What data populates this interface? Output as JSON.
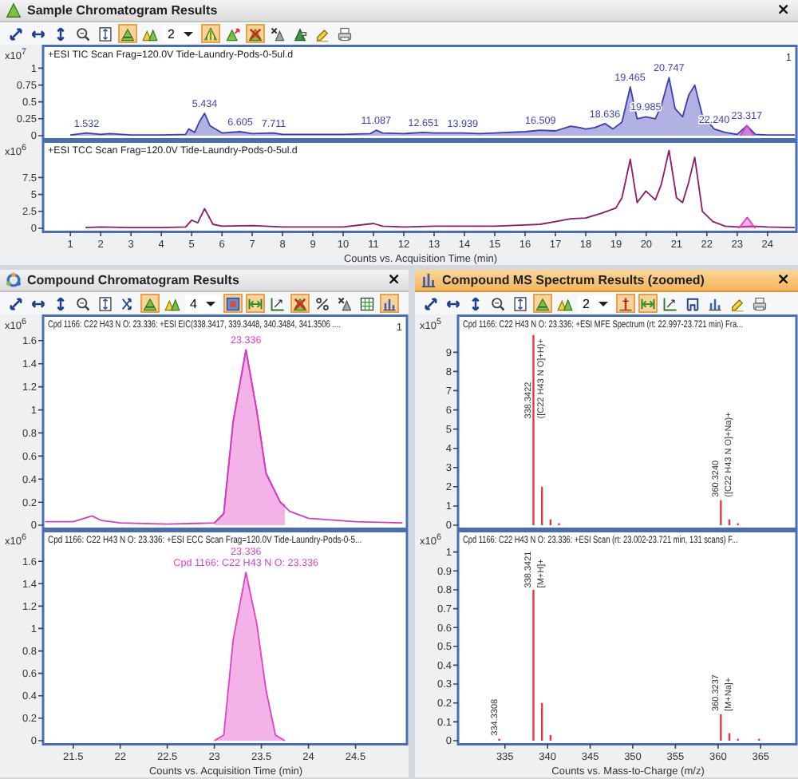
{
  "panels": [
    {
      "kind": "chromatogram",
      "title": "Sample Chromatogram Results",
      "close": "×",
      "active": false,
      "toolbar": [
        {
          "kind": "expand-diag",
          "on": false
        },
        {
          "kind": "expand-h",
          "on": false
        },
        {
          "kind": "expand-v",
          "on": false
        },
        {
          "kind": "zoom",
          "on": false
        },
        {
          "kind": "fit",
          "on": false
        },
        {
          "kind": "peak-label",
          "on": true
        },
        {
          "kind": "peaks",
          "on": false
        },
        {
          "kind": "select",
          "value": "2",
          "on": false
        },
        {
          "kind": "integrate",
          "on": true
        },
        {
          "kind": "peak-add",
          "on": false
        },
        {
          "kind": "no-peaks",
          "on": true
        },
        {
          "kind": "x-peaks",
          "on": false
        },
        {
          "kind": "peak-flag",
          "on": false
        },
        {
          "kind": "highlighter",
          "on": false
        },
        {
          "kind": "printer",
          "on": false
        }
      ],
      "plots": [
        {
          "index_label": "1",
          "chart_data": {
            "type": "area",
            "title": "+ESI TIC Scan Frag=120.0V Tide-Laundry-Pods-0-5ul.d",
            "ylabel": "x10$^{7}$",
            "xlim": [
              0.1,
              24.9
            ],
            "ylim": [
              0,
              1.3
            ],
            "yticks": [
              0,
              0.25,
              0.5,
              0.75,
              1
            ],
            "series": [
              {
                "color": "#3b3fb5",
                "x": [
                  1,
                  1.53,
                  2,
                  2.3,
                  3,
                  4,
                  4.8,
                  4.9,
                  5.1,
                  5.25,
                  5.43,
                  5.6,
                  6,
                  6.6,
                  7,
                  7.7,
                  8,
                  9,
                  10,
                  10.9,
                  11.09,
                  11.3,
                  12,
                  12.65,
                  13,
                  13.94,
                  14.5,
                  15,
                  16,
                  16.5,
                  17,
                  17.5,
                  17.8,
                  18,
                  18.3,
                  18.64,
                  18.9,
                  19.2,
                  19.47,
                  19.7,
                  19.99,
                  20.3,
                  20.5,
                  20.75,
                  20.95,
                  21.2,
                  21.4,
                  21.6,
                  21.85,
                  22.24,
                  22.6,
                  23,
                  23.32,
                  23.6,
                  24,
                  24.9
                ],
                "values": [
                  0.01,
                  0.04,
                  0.02,
                  0.03,
                  0.01,
                  0.01,
                  0.02,
                  0.1,
                  0.05,
                  0.2,
                  0.33,
                  0.15,
                  0.04,
                  0.06,
                  0.03,
                  0.04,
                  0.02,
                  0.02,
                  0.02,
                  0.03,
                  0.08,
                  0.04,
                  0.03,
                  0.05,
                  0.04,
                  0.04,
                  0.03,
                  0.04,
                  0.06,
                  0.08,
                  0.07,
                  0.14,
                  0.12,
                  0.1,
                  0.12,
                  0.18,
                  0.1,
                  0.2,
                  0.72,
                  0.25,
                  0.28,
                  0.25,
                  0.45,
                  0.86,
                  0.4,
                  0.28,
                  0.6,
                  0.75,
                  0.3,
                  0.1,
                  0.05,
                  0.02,
                  0.15,
                  0.02,
                  0.01,
                  0.01
                ]
              },
              {
                "color": "#e040c8",
                "x": [
                  23.1,
                  23.32,
                  23.55
                ],
                "values": [
                  0,
                  0.15,
                  0
                ]
              }
            ],
            "annotations": [
              {
                "x": 1.532,
                "y": 0.04,
                "text": "1.532"
              },
              {
                "x": 5.434,
                "y": 0.33,
                "text": "5.434"
              },
              {
                "x": 6.605,
                "y": 0.06,
                "text": "6.605"
              },
              {
                "x": 7.711,
                "y": 0.04,
                "text": "7.711"
              },
              {
                "x": 11.087,
                "y": 0.08,
                "text": "11.087"
              },
              {
                "x": 12.651,
                "y": 0.05,
                "text": "12.651"
              },
              {
                "x": 13.939,
                "y": 0.04,
                "text": "13.939"
              },
              {
                "x": 16.509,
                "y": 0.08,
                "text": "16.509"
              },
              {
                "x": 18.636,
                "y": 0.18,
                "text": "18.636"
              },
              {
                "x": 19.465,
                "y": 0.72,
                "text": "19.465"
              },
              {
                "x": 19.985,
                "y": 0.28,
                "text": "19.985"
              },
              {
                "x": 20.747,
                "y": 0.86,
                "text": "20.747"
              },
              {
                "x": 22.24,
                "y": 0.1,
                "text": "22.240"
              },
              {
                "x": 23.317,
                "y": 0.15,
                "text": "23.317"
              }
            ]
          }
        },
        {
          "chart_data": {
            "type": "line",
            "title": "+ESI TCC Scan Frag=120.0V Tide-Laundry-Pods-0-5ul.d",
            "ylabel": "x10$^{6}$",
            "xlabel": "Counts vs. Acquisition Time (min)",
            "xlim": [
              0.1,
              24.9
            ],
            "ylim": [
              0,
              12.5
            ],
            "yticks": [
              0,
              2.5,
              5,
              7.5
            ],
            "xticks": [
              1,
              2,
              3,
              4,
              5,
              6,
              7,
              8,
              9,
              10,
              11,
              12,
              13,
              14,
              15,
              16,
              17,
              18,
              19,
              20,
              21,
              22,
              23,
              24
            ],
            "series": [
              {
                "color": "#8b1a6b",
                "x": [
                  1.5,
                  2,
                  3,
                  4,
                  4.8,
                  5,
                  5.2,
                  5.43,
                  5.7,
                  6,
                  7,
                  8,
                  9,
                  10,
                  11,
                  11.3,
                  12,
                  13,
                  14,
                  15,
                  16,
                  16.5,
                  17,
                  17.5,
                  18,
                  18.5,
                  19,
                  19.2,
                  19.47,
                  19.7,
                  19.99,
                  20.3,
                  20.5,
                  20.75,
                  21,
                  21.2,
                  21.4,
                  21.6,
                  21.85,
                  22.2,
                  22.6,
                  23,
                  23.5,
                  24,
                  24.9
                ],
                "values": [
                  0.1,
                  0.2,
                  0.1,
                  0.1,
                  0.2,
                  1.2,
                  0.8,
                  2.9,
                  0.6,
                  0.3,
                  0.4,
                  0.2,
                  0.2,
                  0.2,
                  0.7,
                  0.3,
                  0.2,
                  0.3,
                  0.3,
                  0.3,
                  0.5,
                  0.6,
                  1.0,
                  1.4,
                  1.5,
                  2.2,
                  3.0,
                  4.5,
                  10.2,
                  3.8,
                  5.5,
                  4.2,
                  6.5,
                  11.5,
                  4.5,
                  3.8,
                  6.8,
                  10.5,
                  2.5,
                  1.0,
                  0.3,
                  0.2,
                  0.3,
                  0.2,
                  0.1
                ]
              },
              {
                "type": "area",
                "color": "#e040c8",
                "x": [
                  23.05,
                  23.33,
                  23.6
                ],
                "values": [
                  0,
                  1.6,
                  0
                ]
              }
            ]
          }
        }
      ]
    },
    {
      "kind": "compound",
      "title": "Compound Chromatogram Results",
      "close": "×",
      "active": false,
      "toolbar": [
        {
          "kind": "expand-diag",
          "on": false
        },
        {
          "kind": "expand-h",
          "on": false
        },
        {
          "kind": "expand-v",
          "on": false
        },
        {
          "kind": "zoom",
          "on": false
        },
        {
          "kind": "fit",
          "on": false
        },
        {
          "kind": "swap",
          "on": false
        },
        {
          "kind": "peak-label",
          "on": true
        },
        {
          "kind": "peaks",
          "on": false
        },
        {
          "kind": "select",
          "value": "4",
          "on": false
        },
        {
          "kind": "image",
          "on": true
        },
        {
          "kind": "range",
          "on": true
        },
        {
          "kind": "export",
          "on": false
        },
        {
          "kind": "no-peaks",
          "on": true
        },
        {
          "kind": "percent",
          "on": false
        },
        {
          "kind": "x-peaks",
          "on": false
        },
        {
          "kind": "grid",
          "on": false
        },
        {
          "kind": "bars",
          "on": true
        }
      ],
      "plots": [
        {
          "index_label": "1",
          "chart_data": {
            "type": "line",
            "title": "Cpd 1166: C22 H43 N O: 23.336: +ESI EIC(338.3417, 339.3448, 340.3484, 341.3506 ....",
            "ylabel": "x10$^{6}$",
            "xlim": [
              21.18,
              25.03
            ],
            "ylim": [
              0,
              1.8
            ],
            "yticks": [
              0,
              0.2,
              0.4,
              0.6,
              0.8,
              1,
              1.2,
              1.4,
              1.6
            ],
            "series": [
              {
                "type": "area",
                "color": "#e040c8",
                "x": [
                  23.0,
                  23.1,
                  23.2,
                  23.336,
                  23.45,
                  23.55,
                  23.7,
                  23.75
                ],
                "values": [
                  0.02,
                  0.1,
                  0.9,
                  1.52,
                  1.0,
                  0.45,
                  0.2,
                  0.17
                ]
              },
              {
                "color": "#d33cc0",
                "x": [
                  21.2,
                  21.5,
                  21.7,
                  21.8,
                  22,
                  22.5,
                  23,
                  23.1,
                  23.2,
                  23.336,
                  23.45,
                  23.55,
                  23.7,
                  23.8,
                  24,
                  24.5,
                  25
                ],
                "values": [
                  0.03,
                  0.03,
                  0.08,
                  0.04,
                  0.02,
                  0.01,
                  0.02,
                  0.1,
                  0.9,
                  1.52,
                  1.0,
                  0.45,
                  0.2,
                  0.12,
                  0.06,
                  0.03,
                  0.02
                ]
              }
            ],
            "annotations": [
              {
                "x": 23.336,
                "y": 1.52,
                "text": "23.336"
              }
            ]
          }
        },
        {
          "chart_data": {
            "type": "area",
            "title": "Cpd 1166: C22 H43 N O: 23.336: +ESI ECC Scan Frag=120.0V Tide-Laundry-Pods-0-5...",
            "ylabel": "x10$^{6}$",
            "xlabel": "Counts vs. Acquisition Time (min)",
            "xlim": [
              21.18,
              25.03
            ],
            "ylim": [
              0,
              1.85
            ],
            "yticks": [
              0,
              0.2,
              0.4,
              0.6,
              0.8,
              1,
              1.2,
              1.4,
              1.6
            ],
            "xticks": [
              21.5,
              22,
              22.5,
              23,
              23.5,
              24,
              24.5
            ],
            "series": [
              {
                "color": "#e040c8",
                "x": [
                  23.0,
                  23.1,
                  23.2,
                  23.336,
                  23.45,
                  23.55,
                  23.65,
                  23.75
                ],
                "values": [
                  0,
                  0.05,
                  0.9,
                  1.5,
                  1.05,
                  0.45,
                  0.05,
                  0
                ]
              }
            ],
            "annotations": [
              {
                "x": 23.336,
                "y": 1.5,
                "text": "23.336"
              },
              {
                "x": 23.336,
                "y": 1.5,
                "text": "Cpd 1166: C22 H43 N O: 23.336"
              }
            ]
          }
        }
      ]
    },
    {
      "kind": "spectrum",
      "title": "Compound MS Spectrum Results (zoomed)",
      "close": "×",
      "active": true,
      "toolbar": [
        {
          "kind": "expand-diag",
          "on": false
        },
        {
          "kind": "expand-h",
          "on": false
        },
        {
          "kind": "expand-v",
          "on": false
        },
        {
          "kind": "zoom",
          "on": false
        },
        {
          "kind": "fit",
          "on": false
        },
        {
          "kind": "peak-label",
          "on": true
        },
        {
          "kind": "peaks",
          "on": false
        },
        {
          "kind": "select",
          "value": "2",
          "on": false
        },
        {
          "kind": "mass-bar",
          "on": true
        },
        {
          "kind": "range",
          "on": true
        },
        {
          "kind": "export",
          "on": false
        },
        {
          "kind": "box",
          "on": false
        },
        {
          "kind": "bars",
          "on": false
        },
        {
          "kind": "highlighter",
          "on": false
        },
        {
          "kind": "printer",
          "on": false
        }
      ],
      "plots": [
        {
          "chart_data": {
            "type": "bar",
            "title": "Cpd 1166: C22 H43 N O: 23.336: +ESI MFE Spectrum (rt: 22.997-23.721 min) Fra...",
            "ylabel": "x10$^{5}$",
            "xlim": [
              329.5,
              369
            ],
            "ylim": [
              0,
              10.8
            ],
            "yticks": [
              0,
              1,
              2,
              3,
              4,
              5,
              6,
              7,
              8,
              9
            ],
            "series": [
              {
                "color": "#e8383d",
                "x": [
                  338.3422,
                  339.345,
                  340.348,
                  341.35,
                  360.324,
                  361.327,
                  362.33
                ],
                "values": [
                  9.9,
                  2,
                  0.3,
                  0.1,
                  1.3,
                  0.3,
                  0.1
                ]
              }
            ],
            "annotations": [
              "338.3422",
              "([C22 H43 N O]+H)+",
              {
                "x": 360.324,
                "y": 1.3,
                "text": "360.3240"
              },
              {
                "x": 360.324,
                "y": 1.3,
                "text": "([C22 H43 N O]+Na)+"
              }
            ]
          }
        },
        {
          "chart_data": {
            "type": "bar",
            "title": "Cpd 1166: C22 H43 N O: 23.336: +ESI Scan (rt: 23.002-23.721 min, 131 scans) F...",
            "ylabel": "x10$^{6}$",
            "xlabel": "Counts vs. Mass-to-Charge (m/z)",
            "xlim": [
              329.5,
              369
            ],
            "ylim": [
              0,
              1.1
            ],
            "yticks": [
              0,
              0.1,
              0.2,
              0.3,
              0.4,
              0.5,
              0.6,
              0.7,
              0.8,
              0.9,
              1
            ],
            "xticks": [
              335,
              340,
              345,
              350,
              355,
              360,
              365
            ],
            "series": [
              {
                "color": "#e8383d",
                "x": [
                  334.3308,
                  338.3421,
                  339.345,
                  340.35,
                  360.3237,
                  361.327,
                  362.33,
                  364.8
                ],
                "values": [
                  0.01,
                  0.8,
                  0.2,
                  0.03,
                  0.14,
                  0.04,
                  0.01,
                  0.01
                ]
              }
            ],
            "annotations": [
              {
                "x": 334.3308,
                "y": 0.01,
                "text": "334.3308"
              },
              {
                "x": 338.3421,
                "y": 0.8,
                "text": "338.3421"
              },
              {
                "x": 338.3421,
                "y": 0.8,
                "text": "[M+H]+"
              },
              {
                "x": 360.3237,
                "y": 0.14,
                "text": "360.3237"
              },
              {
                "x": 360.3237,
                "y": 0.14,
                "text": "[M+Na]+"
              }
            ]
          }
        }
      ]
    }
  ]
}
